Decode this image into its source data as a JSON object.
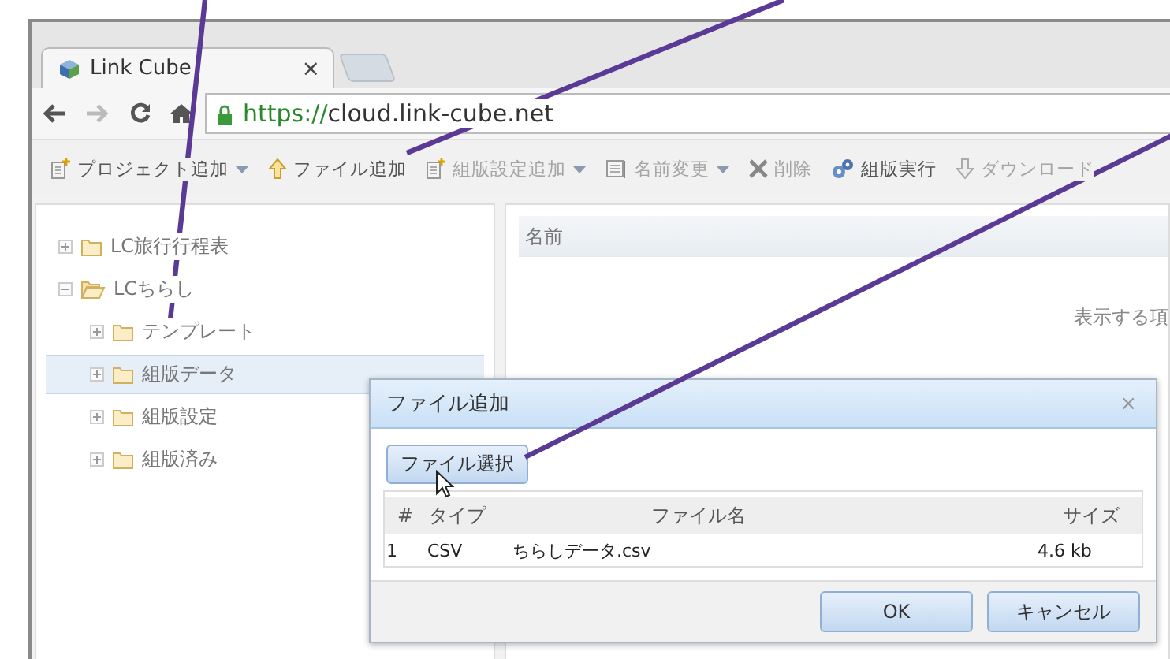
{
  "browser": {
    "tab": {
      "title": "Link Cube",
      "close": "×"
    },
    "url": {
      "scheme": "https://",
      "host": "cloud.link-cube.net"
    }
  },
  "toolbar": [
    {
      "label": "プロジェクト追加",
      "kind": "dropdown",
      "disabled": false
    },
    {
      "label": "ファイル追加",
      "kind": "button",
      "disabled": false
    },
    {
      "label": "組版設定追加",
      "kind": "dropdown",
      "disabled": true
    },
    {
      "label": "名前変更",
      "kind": "dropdown",
      "disabled": true
    },
    {
      "label": "削除",
      "kind": "button",
      "disabled": true
    },
    {
      "label": "組版実行",
      "kind": "button",
      "disabled": false
    },
    {
      "label": "ダウンロード",
      "kind": "button",
      "disabled": true
    }
  ],
  "tree": [
    {
      "label": "LC旅行行程表",
      "expanded": false,
      "selected": false
    },
    {
      "label": "LCちらし",
      "expanded": true,
      "selected": false,
      "children": [
        {
          "label": "テンプレート",
          "expanded": false,
          "selected": false
        },
        {
          "label": "組版データ",
          "expanded": false,
          "selected": true
        },
        {
          "label": "組版設定",
          "expanded": false,
          "selected": false
        },
        {
          "label": "組版済み",
          "expanded": false,
          "selected": false
        }
      ]
    }
  ],
  "list": {
    "column": "名前",
    "empty_text": "表示する項"
  },
  "dialog": {
    "title": "ファイル追加",
    "close": "×",
    "select_button": "ファイル選択",
    "columns": [
      "#",
      "タイプ",
      "ファイル名",
      "サイズ"
    ],
    "rows": [
      [
        "1",
        "CSV",
        "ちらしデータ.csv",
        "4.6 kb"
      ]
    ],
    "buttons": [
      "OK",
      "キャンセル"
    ]
  }
}
